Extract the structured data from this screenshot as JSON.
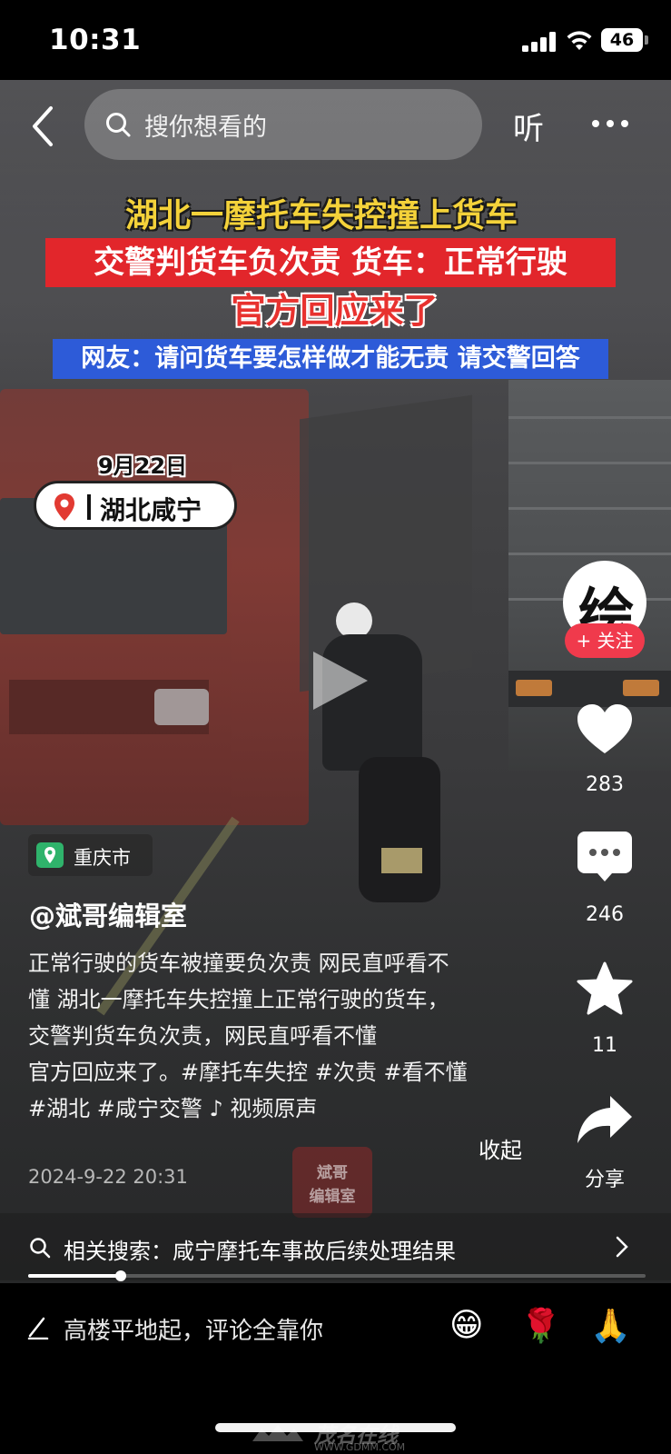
{
  "status_bar": {
    "time": "10:31",
    "battery": "46"
  },
  "nav": {
    "search_placeholder": "搜你想看的",
    "listen_label": "听"
  },
  "headline": {
    "line1": "湖北一摩托车失控撞上货车",
    "line2": "交警判货车负次责 货车：正常行驶",
    "line3": "官方回应来了",
    "line4": "网友：请问货车要怎样做才能无责 请交警回答"
  },
  "overlay": {
    "date": "9月22日",
    "location": "湖北咸宁"
  },
  "rail": {
    "avatar_char": "绘",
    "follow_label": "+ 关注",
    "like_count": "283",
    "comment_count": "246",
    "favorite_count": "11",
    "share_label": "分享"
  },
  "caption": {
    "location_tag": "重庆市",
    "author": "@斌哥编辑室",
    "description_lines": [
      "正常行驶的货车被撞要负次责 网民直呼看不",
      "懂 湖北一摩托车失控撞上正常行驶的货车，",
      "交警判货车负次责，网民直呼看不懂",
      "官方回应来了。#摩托车失控 #次责 #看不懂",
      "#湖北 #咸宁交警 ♪ 视频原声"
    ],
    "collapse_label": "收起",
    "post_time": "2024-9-22 20:31",
    "watermark_line1": "斌哥",
    "watermark_line2": "编辑室"
  },
  "related_search": {
    "text": "相关搜索：咸宁摩托车事故后续处理结果"
  },
  "progress": {
    "fraction": 0.15
  },
  "comment_bar": {
    "placeholder": "高楼平地起，评论全靠你",
    "emojis": [
      "😁",
      "🌹",
      "🙏"
    ]
  },
  "site_watermark": {
    "name": "茂名在线",
    "url": "WWW.GDMM.COM"
  },
  "colors": {
    "follow": "#f03a4c",
    "headline_red": "#e2262b",
    "headline_blue": "#2d5bd8",
    "headline_yellow": "#f4d23a",
    "location_green": "#2fb36b"
  }
}
